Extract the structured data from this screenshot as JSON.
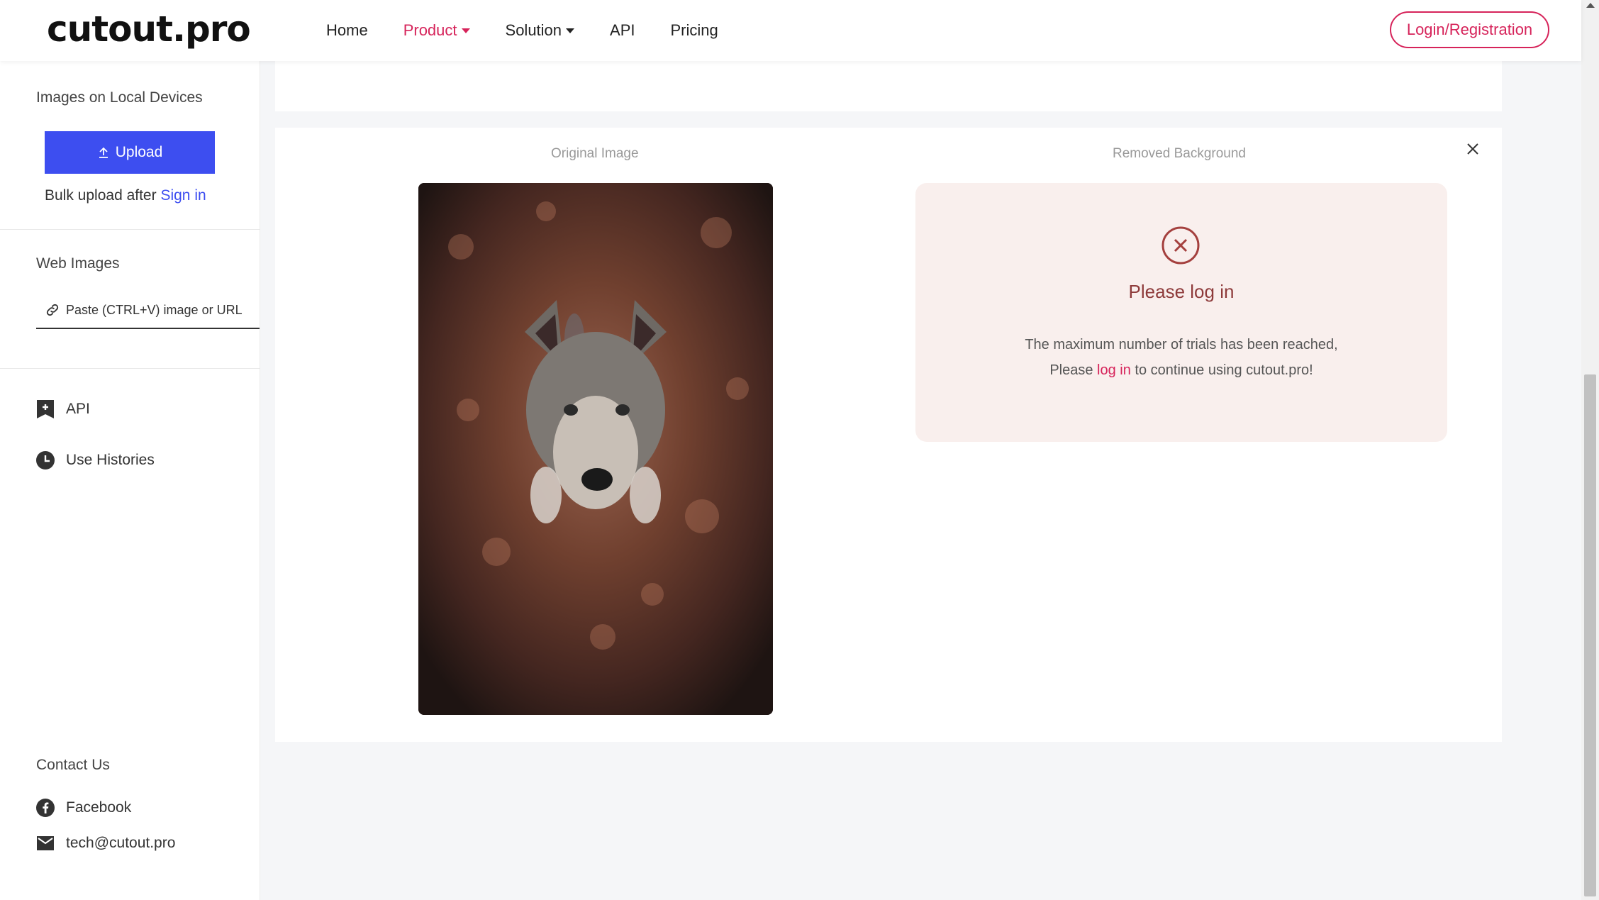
{
  "header": {
    "logo": "cutout.pro",
    "nav": [
      {
        "label": "Home"
      },
      {
        "label": "Product"
      },
      {
        "label": "Solution"
      },
      {
        "label": "API"
      },
      {
        "label": "Pricing"
      }
    ],
    "login_label": "Login/Registration",
    "accent_color": "#d6235a"
  },
  "sidebar": {
    "local_heading": "Images on Local Devices",
    "upload_label": "Upload",
    "bulk_text": "Bulk upload after",
    "sign_in": "Sign in",
    "web_heading": "Web Images",
    "url_placeholder": "Paste (CTRL+V) image or URL",
    "links": [
      {
        "label": "API",
        "icon": "api-bookmark-icon"
      },
      {
        "label": "Use Histories",
        "icon": "clock-icon"
      }
    ],
    "contact_heading": "Contact Us",
    "contacts": [
      {
        "label": "Facebook",
        "icon": "facebook-icon"
      },
      {
        "label": "tech@cutout.pro",
        "icon": "mail-icon"
      }
    ],
    "upload_color": "#3d4ef0"
  },
  "main": {
    "original_label": "Original Image",
    "removed_label": "Removed Background",
    "notice": {
      "title": "Please log in",
      "line1": "The maximum number of trials has been reached,",
      "line2_pre": "Please",
      "line2_link": "log in",
      "line2_post": "to continue using cutout.pro!"
    }
  }
}
